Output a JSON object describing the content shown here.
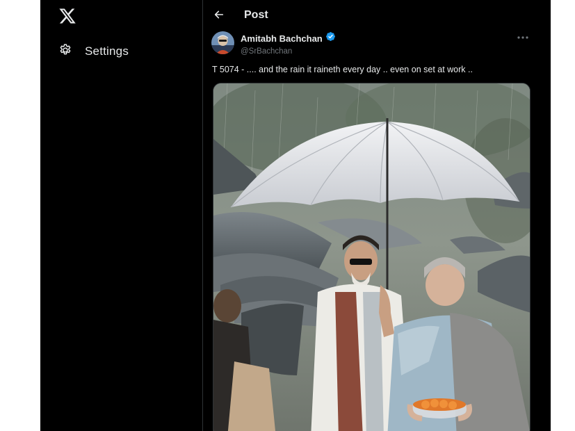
{
  "nav": {
    "logo": "x-logo-icon",
    "items": [
      {
        "label": "Settings",
        "icon": "gear-icon"
      }
    ]
  },
  "header": {
    "back_icon": "arrow-left-icon",
    "title": "Post"
  },
  "post": {
    "author": {
      "name": "Amitabh Bachchan",
      "handle": "@SrBachchan",
      "verified_icon": "verified-badge-icon"
    },
    "more_icon": "more-icon",
    "text": "T 5074 - .... and the rain it raineth every day .. even on set at work ..",
    "media": "photo"
  },
  "colors": {
    "background": "#000000",
    "text": "#e7e9ea",
    "secondary_text": "#71767b",
    "accent": "#1d9bf0",
    "divider": "#2f3336"
  }
}
